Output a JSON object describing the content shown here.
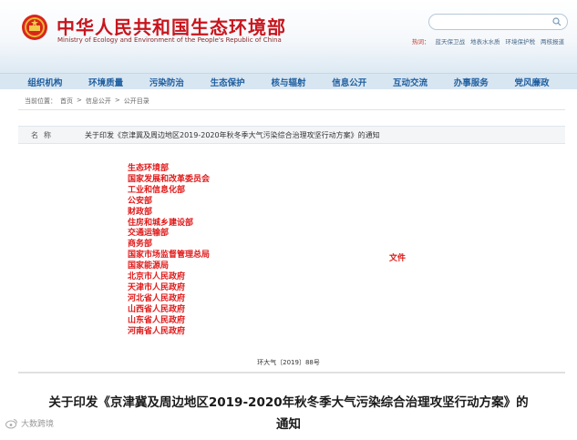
{
  "header": {
    "title": "中华人民共和国生态环境部",
    "subtitle": "Ministry of Ecology and Environment of the People's Republic of China",
    "search_placeholder": "",
    "quick_links_head": "热词：",
    "quick_links": [
      "蓝天保卫战",
      "地表水水质",
      "环境保护税",
      "两核报道"
    ]
  },
  "nav": {
    "items": [
      "组织机构",
      "环境质量",
      "污染防治",
      "生态保护",
      "核与辐射",
      "信息公开",
      "互动交流",
      "办事服务",
      "党风廉政"
    ]
  },
  "breadcrumb": {
    "prefix": "当前位置：",
    "items": [
      "首页",
      "信息公开",
      "公开目录"
    ],
    "separator": ">"
  },
  "name_row": {
    "label": "名称",
    "value": "关于印发《京津冀及周边地区2019-2020年秋冬季大气污染综合治理攻坚行动方案》的通知"
  },
  "document": {
    "recipients": [
      "生态环境部",
      "国家发展和改革委员会",
      "工业和信息化部",
      "公安部",
      "财政部",
      "住房和城乡建设部",
      "交通运输部",
      "商务部",
      "国家市场监督管理总局",
      "国家能源局",
      "北京市人民政府",
      "天津市人民政府",
      "河北省人民政府",
      "山西省人民政府",
      "山东省人民政府",
      "河南省人民政府"
    ],
    "doc_word": "文件",
    "doc_number": "环大气〔2019〕88号",
    "title_line1": "关于印发《京津冀及周边地区2019-2020年秋冬季大气污染综合治理攻坚行动方案》的",
    "title_line2": "通知"
  },
  "watermark": {
    "text": "大数跨境"
  },
  "colors": {
    "brand_red": "#c8151d",
    "doc_red": "#e01919",
    "nav_blue": "#1f5fa0",
    "nav_bg": "#d8e6f2"
  }
}
